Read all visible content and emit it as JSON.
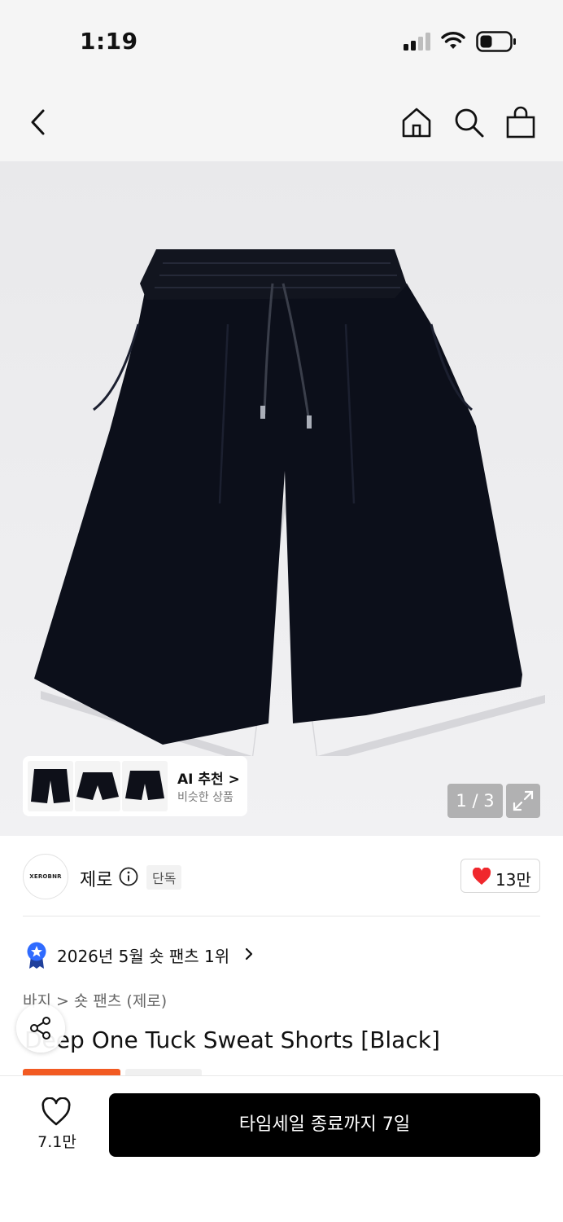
{
  "status_bar": {
    "time": "1:19"
  },
  "nav": {
    "back_icon": "chevron-left-icon",
    "home_icon": "home-icon",
    "search_icon": "search-icon",
    "cart_icon": "shopping-bag-icon"
  },
  "gallery": {
    "ai_title": "AI 추천 >",
    "ai_sub": "비슷한 상품",
    "page_counter": "1 / 3"
  },
  "brand": {
    "logo_text": "XEROBNR",
    "name": "제로",
    "exclusive_badge": "단독",
    "like_count": "13만"
  },
  "ranking": {
    "text": "2026년 5월 숏 팬츠 1위"
  },
  "breadcrumb": {
    "level1": "바지",
    "separator": ">",
    "level2": "숏 팬츠 (제로)"
  },
  "product": {
    "title": "Deep One Tuck Sweat Shorts [Black]"
  },
  "bottom_bar": {
    "wish_count": "7.1만",
    "cta_label": "타임세일 종료까지 7일"
  },
  "colors": {
    "accent_red": "#f0282d",
    "sale_orange": "#f25a22",
    "rank_blue": "#2f6bff",
    "cta_black": "#000000"
  }
}
